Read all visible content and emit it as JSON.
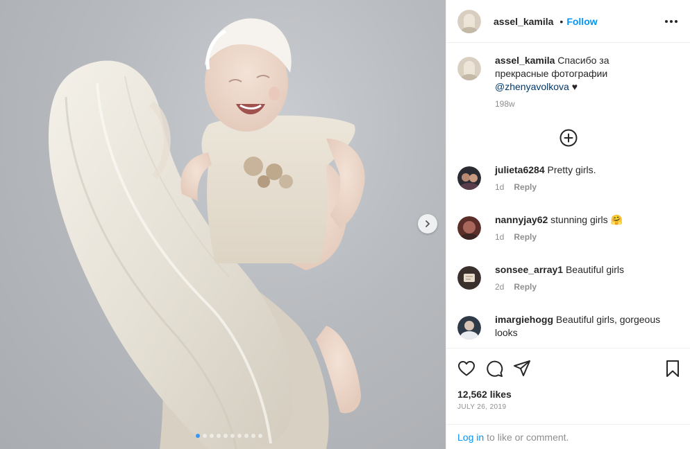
{
  "post": {
    "author": "assel_kamila",
    "separator": "•",
    "follow_label": "Follow",
    "more_icon": "ellipsis-icon"
  },
  "caption": {
    "username": "assel_kamila",
    "text": "Спасибо за прекрасные фотографии",
    "mention": "@zhenyavolkova",
    "heart": "♥",
    "age": "198w"
  },
  "load_more_icon": "plus-circle-icon",
  "comments": [
    {
      "username": "julieta6284",
      "text": "Pretty girls.",
      "age": "1d",
      "reply": "Reply"
    },
    {
      "username": "nannyjay62",
      "text": "stunning girls 🤗",
      "age": "1d",
      "reply": "Reply"
    },
    {
      "username": "sonsee_array1",
      "text": "Beautiful girls",
      "age": "2d",
      "reply": "Reply"
    },
    {
      "username": "imargiehogg",
      "text": "Beautiful girls, gorgeous looks",
      "age": "",
      "reply": ""
    }
  ],
  "actions": [
    "heart-icon",
    "comment-icon",
    "share-icon",
    "bookmark-icon"
  ],
  "likes": {
    "count": "12,562 likes",
    "date": "JULY 26, 2019"
  },
  "login_bar": {
    "link": "Log in",
    "text": "to like or comment."
  },
  "carousel": {
    "total_slides": 10,
    "active_index": 0
  },
  "colors": {
    "link_blue": "#0095f6",
    "mention_blue": "#00376b",
    "muted": "#8e8e8e",
    "active_dot": "#3897f0"
  }
}
